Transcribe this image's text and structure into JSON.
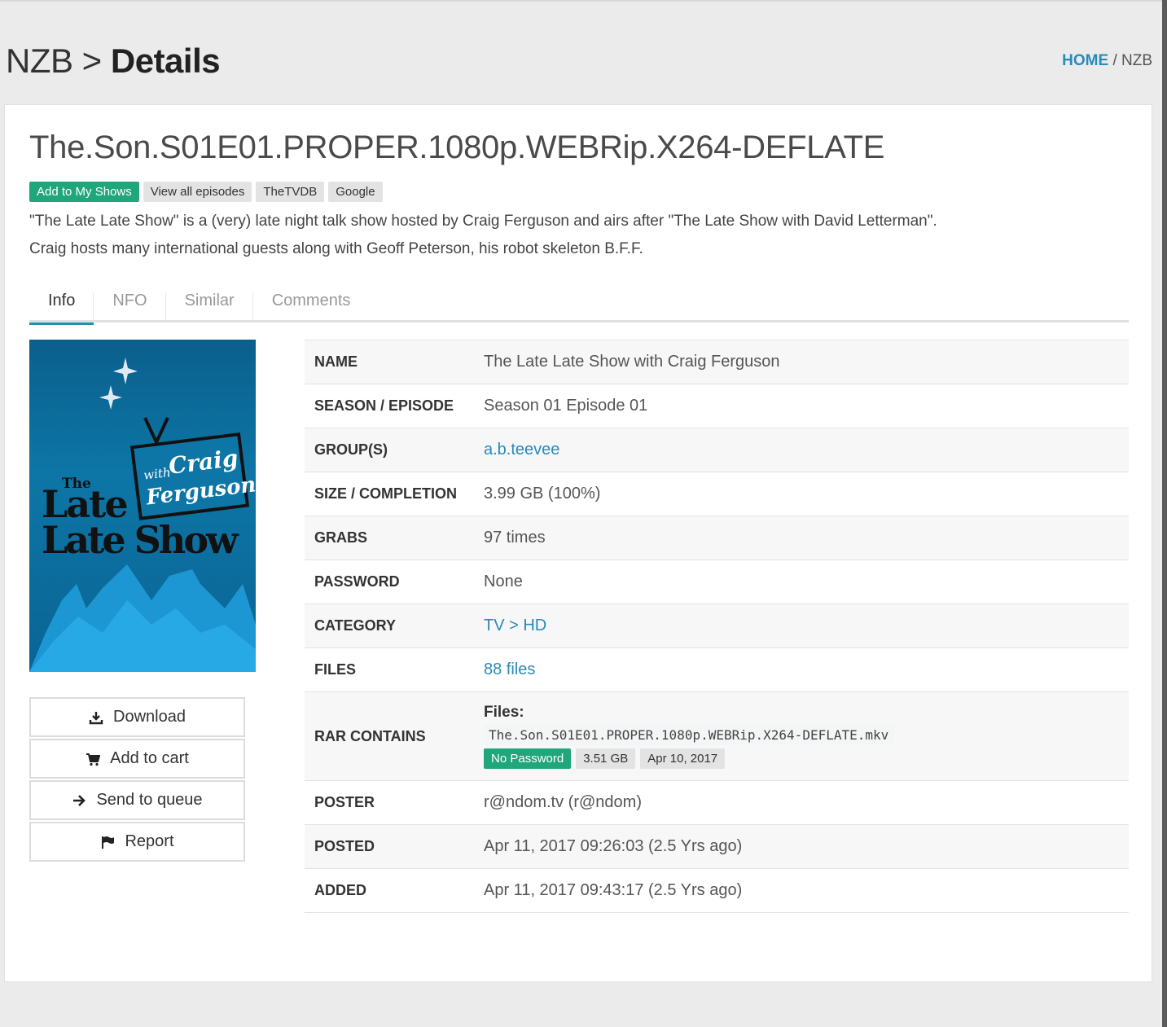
{
  "header": {
    "title_prefix": "NZB >",
    "title_main": "Details",
    "breadcrumb_home": "HOME",
    "breadcrumb_sep": "/",
    "breadcrumb_current": "NZB"
  },
  "release": {
    "title": "The.Son.S01E01.PROPER.1080p.WEBRip.X264-DEFLATE",
    "badges": {
      "add_shows": "Add to My Shows",
      "view_episodes": "View all episodes",
      "tvdb": "TheTVDB",
      "google": "Google"
    },
    "description_line1": "\"The Late Late Show\" is a (very) late night talk show hosted by Craig Ferguson and airs after \"The Late Show with David Letterman\".",
    "description_line2": "Craig hosts many international guests along with Geoff Peterson, his robot skeleton B.F.F."
  },
  "tabs": [
    "Info",
    "NFO",
    "Similar",
    "Comments"
  ],
  "poster": {
    "the": "The",
    "late": "Late",
    "late_show": "Late Show",
    "with": "with",
    "craig": "Craig",
    "ferguson": "Ferguson"
  },
  "actions": {
    "download": "Download",
    "add_cart": "Add to cart",
    "send_queue": "Send to queue",
    "report": "Report"
  },
  "info": {
    "name_label": "NAME",
    "name_value": "The Late Late Show with Craig Ferguson",
    "season_label": "SEASON / EPISODE",
    "season_value": "Season 01 Episode 01",
    "group_label": "GROUP(S)",
    "group_value": "a.b.teevee",
    "size_label": "SIZE / COMPLETION",
    "size_value": "3.99 GB (100%)",
    "grabs_label": "GRABS",
    "grabs_value": "97 times",
    "password_label": "PASSWORD",
    "password_value": "None",
    "category_label": "CATEGORY",
    "category_value": "TV > HD",
    "files_label": "FILES",
    "files_value": "88 files",
    "rar_label": "RAR CONTAINS",
    "rar_files_heading": "Files:",
    "rar_filename": "The.Son.S01E01.PROPER.1080p.WEBRip.X264-DEFLATE.mkv",
    "rar_password_badge": "No Password",
    "rar_size_badge": "3.51 GB",
    "rar_date_badge": "Apr 10, 2017",
    "poster_label": "POSTER",
    "poster_value": "r@ndom.tv (r@ndom)",
    "posted_label": "POSTED",
    "posted_value": "Apr 11, 2017 09:26:03 (2.5 Yrs ago)",
    "added_label": "ADDED",
    "added_value": "Apr 11, 2017 09:43:17 (2.5 Yrs ago)"
  },
  "colors": {
    "accent": "#2a8ab8",
    "success": "#1fa67a"
  }
}
